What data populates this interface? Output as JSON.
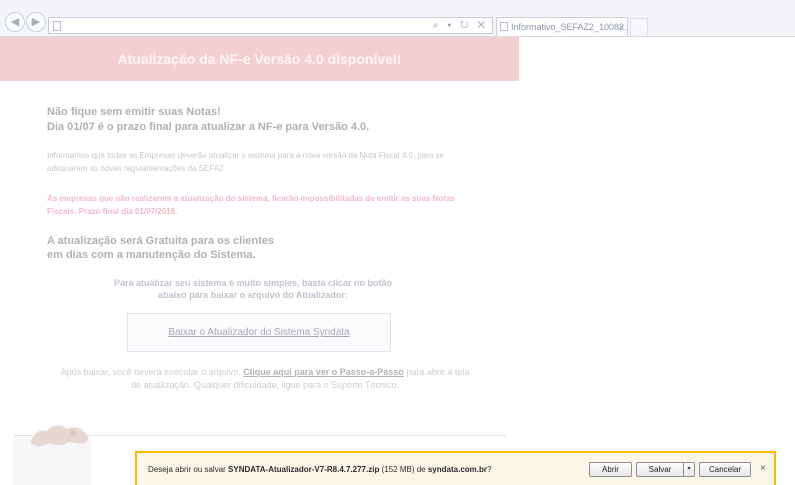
{
  "browser": {
    "back_glyph": "◀",
    "forward_glyph": "▶",
    "address_tools": "⌕ ▾ ↻ ✕",
    "tab_title": "Informativo_SEFAZ2_10082...",
    "tab_close": "×"
  },
  "page": {
    "banner_title": "Atualização da NF-e Versão 4.0 disponível!",
    "urgent_line1": "Não fique sem emitir suas Notas!",
    "urgent_line2": "Dia 01/07 é o prazo final para atualizar a NF-e para Versão 4.0.",
    "info_text": "Informamos que todas as Empresas deverão atualizar o sistema para a nova versão da Nota Fiscal 4.0, para se adequarem as novas regulamentações da SEFAZ.",
    "warning_text": "As empresas que não realizarem a atualização do sistema, ficarão impossibilitadas de emitir as suas Notas Fiscais. Prazo final dia 01/07/2018.",
    "free_line1": "A atualização será Gratuita para os clientes",
    "free_line2": "em dias com a manutenção do Sistema.",
    "instruction": "Para atualizar seu sistema é muito simples, basta clicar no botão abaixo para baixar o arquivo do Atualizador:",
    "download_button": "Baixar o Atualizador do Sistema Syndata",
    "after_prefix": "Após baixar, você deverá executar o arquivo.",
    "after_link": "Clique aqui para ver o Passo-a-Passo",
    "after_suffix": "para abrir a tela de atualização. Qualquer dificuldade, ligue para o Suporte Técnico."
  },
  "download_bar": {
    "msg_prefix": "Deseja abrir ou salvar",
    "filename": "SYNDATA-Atualizador-V7-R8.4.7.277.zip",
    "size": "(152 MB)",
    "msg_middle": "de",
    "domain": "syndata.com.br",
    "msg_suffix": "?",
    "open_label": "Abrir",
    "save_label": "Salvar",
    "cancel_label": "Cancelar",
    "close_glyph": "×",
    "dropdown_glyph": "▾"
  },
  "colors": {
    "banner": "#f4cfd0",
    "warning_text": "#f3b9c5",
    "download_bar_border": "#ffb700",
    "download_bar_bg": "#fbf7e8"
  },
  "icons": {
    "back": "back-arrow-icon",
    "forward": "forward-arrow-icon",
    "page": "page-icon",
    "search": "search-icon",
    "refresh": "refresh-icon",
    "stop": "stop-icon",
    "tab_close": "close-icon",
    "bar_close": "close-icon",
    "save_dropdown": "chevron-down-icon",
    "logo": "company-logo"
  }
}
